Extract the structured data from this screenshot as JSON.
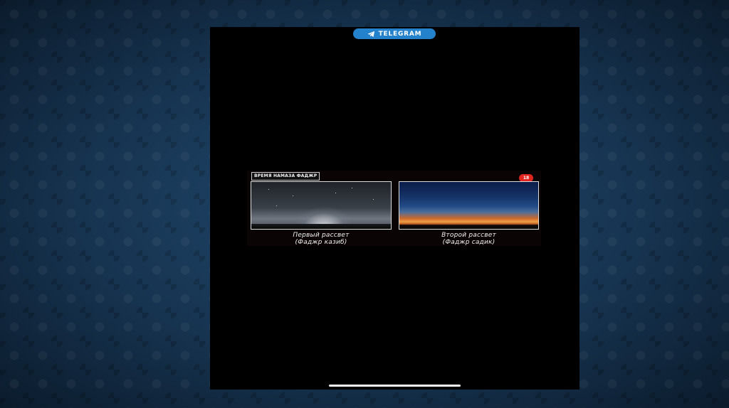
{
  "telegram_badge": {
    "label": "TELEGRAM",
    "icon": "telegram-paper-plane-icon",
    "color": "#2481cc"
  },
  "post": {
    "title": "ВРЕМЯ НАМАЗА ФАДЖР",
    "age_badge": "18",
    "age_badge_color": "#e2241f",
    "images": [
      {
        "caption_line1": "Первый рассвет",
        "caption_line2": "(Фаджр казиб)"
      },
      {
        "caption_line1": "Второй рассвет",
        "caption_line2": "(Фаджр садик)"
      }
    ]
  },
  "colors": {
    "background": "#16314d",
    "phone_screen": "#000000"
  }
}
